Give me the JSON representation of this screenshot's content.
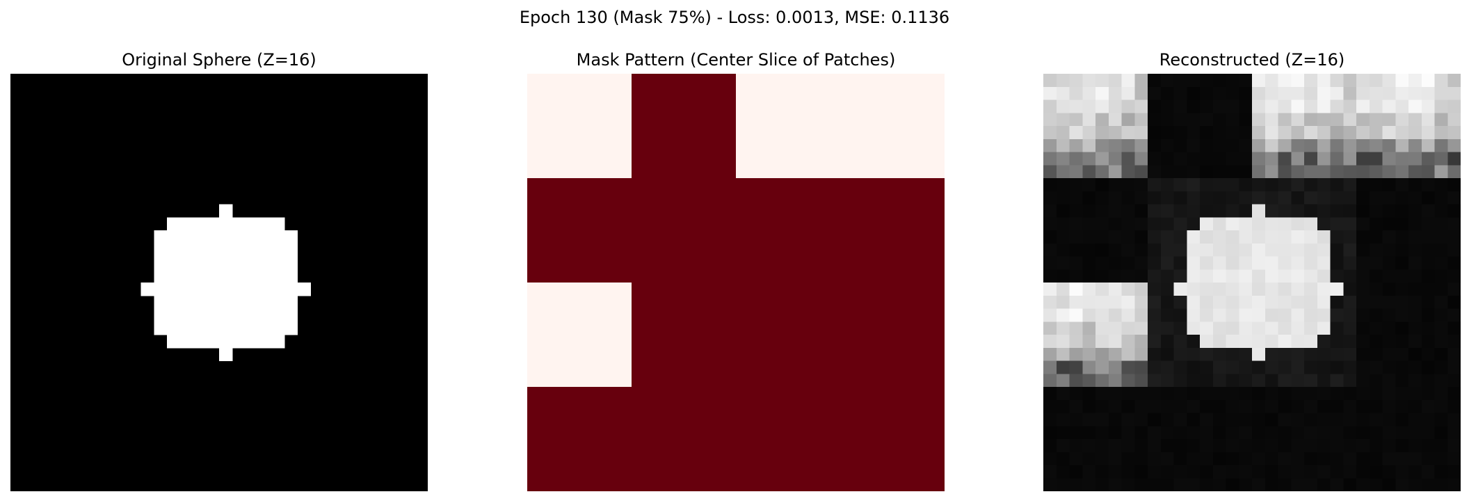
{
  "title": "Epoch 130 (Mask 75%) - Loss: 0.0013, MSE: 0.1136",
  "chart_data": [
    {
      "type": "heatmap",
      "title": "Original Sphere (Z=16)",
      "grid_size": 32,
      "colormap": "gray",
      "axes": "off",
      "mask": [
        "................................",
        "................................",
        "................................",
        "................................",
        "................................",
        "................................",
        "................................",
        "................................",
        "................................",
        "................................",
        "................#...............",
        "............#########...........",
        "...........###########..........",
        "...........###########..........",
        "...........###########..........",
        "...........###########..........",
        "..........#############.........",
        "...........###########..........",
        "...........###########..........",
        "...........###########..........",
        "............#########...........",
        "................#...............",
        "................................",
        "................................",
        "................................",
        "................................",
        "................................",
        "................................",
        "................................",
        "................................",
        "................................",
        "................................"
      ]
    },
    {
      "type": "heatmap",
      "title": "Mask Pattern (Center Slice of Patches)",
      "colormap": "Reds",
      "axes": "off",
      "colors": {
        "visible": "#fff4f0",
        "masked": "#67000d"
      },
      "values": [
        [
          0,
          1,
          0,
          0
        ],
        [
          1,
          1,
          1,
          1
        ],
        [
          0,
          1,
          1,
          1
        ],
        [
          1,
          1,
          1,
          1
        ]
      ]
    },
    {
      "type": "heatmap",
      "title": "Reconstructed (Z=16)",
      "colormap": "gray",
      "axes": "off",
      "patch_grid": 4,
      "patch_size": 8,
      "patch_types": [
        [
          "T",
          "D",
          "T",
          "T"
        ],
        [
          "D",
          "C",
          "C",
          "D"
        ],
        [
          "T",
          "C",
          "C",
          "D"
        ],
        [
          "D",
          "D",
          "D",
          "D"
        ]
      ],
      "patch_type_legend": {
        "T": "bright reconstructed pattern",
        "D": "dark",
        "C": "sphere region"
      }
    }
  ]
}
